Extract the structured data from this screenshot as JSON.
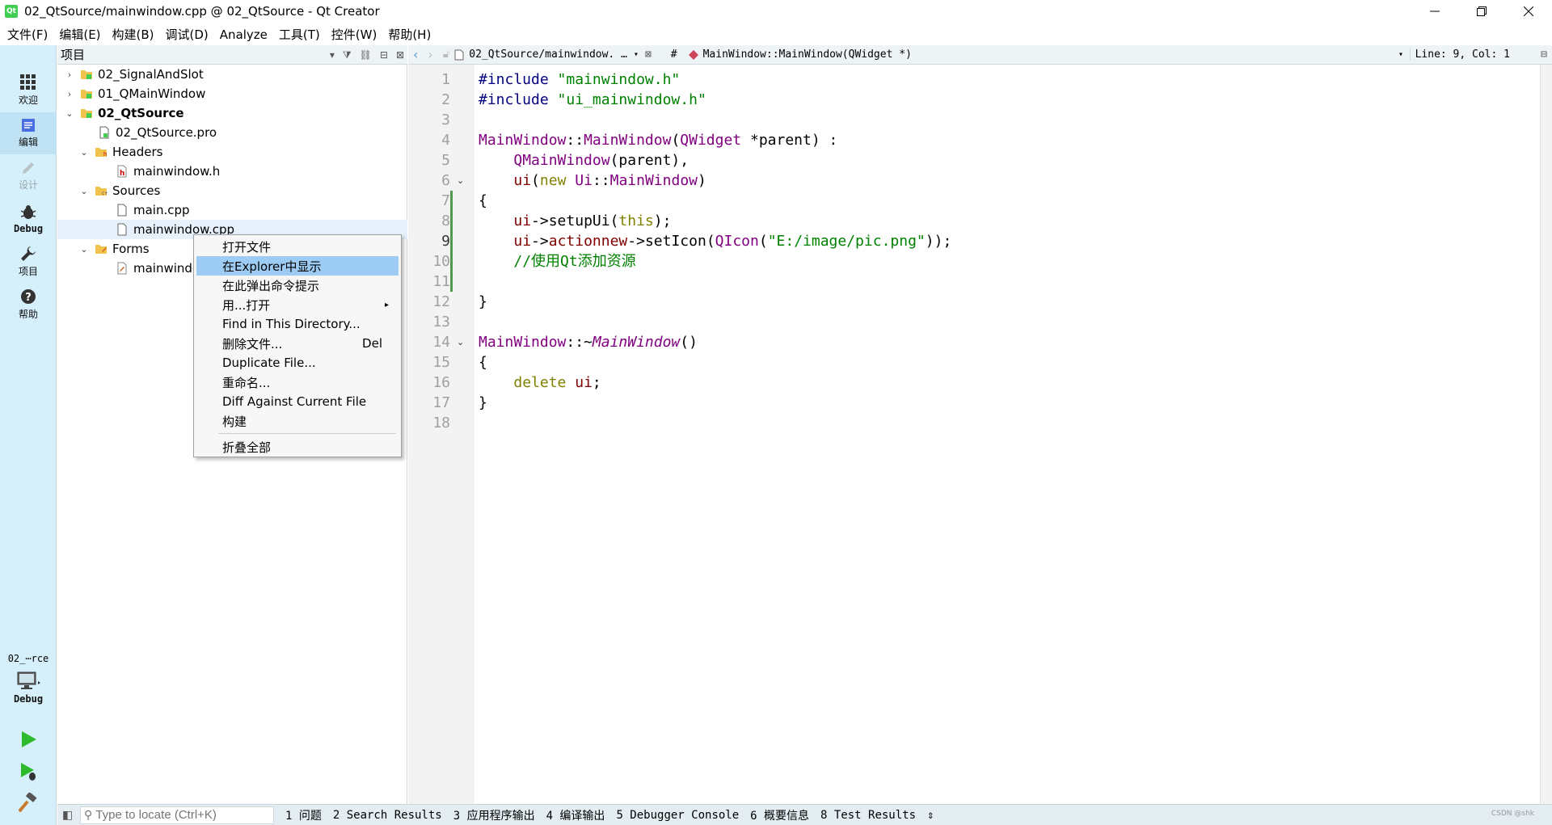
{
  "window": {
    "title": "02_QtSource/mainwindow.cpp @ 02_QtSource - Qt Creator",
    "icon_text": "Qt"
  },
  "menu": [
    "文件(F)",
    "编辑(E)",
    "构建(B)",
    "调试(D)",
    "Analyze",
    "工具(T)",
    "控件(W)",
    "帮助(H)"
  ],
  "modes": [
    {
      "label": "欢迎",
      "icon": "grid-icon"
    },
    {
      "label": "编辑",
      "icon": "edit-doc-icon"
    },
    {
      "label": "设计",
      "icon": "pencil-icon"
    },
    {
      "label": "Debug",
      "icon": "bug-icon"
    },
    {
      "label": "项目",
      "icon": "wrench-icon"
    },
    {
      "label": "帮助",
      "icon": "help-icon"
    }
  ],
  "kit": {
    "project": "02_⋯rce",
    "mode": "Debug"
  },
  "project_pane": {
    "header": "项目"
  },
  "tree": [
    {
      "label": "02_SignalAndSlot",
      "depth": 0,
      "arrow": "right",
      "icon": "project-folder-icon"
    },
    {
      "label": "01_QMainWindow",
      "depth": 0,
      "arrow": "right",
      "icon": "project-folder-icon"
    },
    {
      "label": "02_QtSource",
      "depth": 0,
      "arrow": "down",
      "icon": "project-folder-icon",
      "bold": true
    },
    {
      "label": "02_QtSource.pro",
      "depth": 1,
      "arrow": "",
      "icon": "pro-file-icon"
    },
    {
      "label": "Headers",
      "depth": 1,
      "arrow": "down",
      "icon": "headers-folder-icon"
    },
    {
      "label": "mainwindow.h",
      "depth": 2,
      "arrow": "",
      "icon": "header-file-icon"
    },
    {
      "label": "Sources",
      "depth": 1,
      "arrow": "down",
      "icon": "sources-folder-icon"
    },
    {
      "label": "main.cpp",
      "depth": 2,
      "arrow": "",
      "icon": "cpp-file-icon"
    },
    {
      "label": "mainwindow.cpp",
      "depth": 2,
      "arrow": "",
      "icon": "cpp-file-icon",
      "selected": true
    },
    {
      "label": "Forms",
      "depth": 1,
      "arrow": "down",
      "icon": "forms-folder-icon"
    },
    {
      "label": "mainwindow.ui",
      "depth": 2,
      "arrow": "",
      "icon": "ui-file-icon"
    }
  ],
  "context_menu": [
    {
      "label": "打开文件"
    },
    {
      "label": "在Explorer中显示",
      "highlighted": true
    },
    {
      "label": "在此弹出命令提示"
    },
    {
      "label": "用...打开",
      "submenu": true
    },
    {
      "label": "Find in This Directory..."
    },
    {
      "label": "删除文件...",
      "shortcut": "Del"
    },
    {
      "label": "Duplicate File..."
    },
    {
      "label": "重命名..."
    },
    {
      "label": "Diff Against Current File"
    },
    {
      "label": "构建"
    },
    {
      "label": "折叠全部",
      "after_separator": true
    }
  ],
  "editor_toolbar": {
    "file": "02_QtSource/mainwindow. …",
    "hash": "#",
    "symbol": "MainWindow::MainWindow(QWidget *)",
    "position": "Line: 9, Col: 1"
  },
  "code_lines": [
    {
      "n": "1",
      "html": "<span class='k-pp'>#include</span> <span class='k-str'>\"mainwindow.h\"</span>"
    },
    {
      "n": "2",
      "html": "<span class='k-pp'>#include</span> <span class='k-str'>\"ui_mainwindow.h\"</span>"
    },
    {
      "n": "3",
      "html": ""
    },
    {
      "n": "4",
      "html": "<span class='k-type'>MainWindow</span>::<span class='k-type'>MainWindow</span>(<span class='k-type'>QWidget</span> *parent) :"
    },
    {
      "n": "5",
      "html": "    <span class='k-type'>QMainWindow</span>(parent),"
    },
    {
      "n": "6",
      "html": "    <span class='k-mem'>ui</span>(<span class='k-kw'>new</span> <span class='k-type'>Ui</span>::<span class='k-type'>MainWindow</span>)"
    },
    {
      "n": "7",
      "html": "{"
    },
    {
      "n": "8",
      "html": "    <span class='k-mem'>ui</span>->setupUi(<span class='k-kw'>this</span>);"
    },
    {
      "n": "9",
      "html": "    <span class='k-mem'>ui</span>-><span class='k-mem'>actionnew</span>->setIcon(<span class='k-type'>QIcon</span>(<span class='k-str'>\"E:/image/pic.png\"</span>));"
    },
    {
      "n": "10",
      "html": "    <span class='k-cmt'>//使用Qt添加资源</span>"
    },
    {
      "n": "11",
      "html": ""
    },
    {
      "n": "12",
      "html": "}"
    },
    {
      "n": "13",
      "html": ""
    },
    {
      "n": "14",
      "html": "<span class='k-type'>MainWindow</span>::~<span class='k-type'><i>MainWindow</i></span>()"
    },
    {
      "n": "15",
      "html": "{"
    },
    {
      "n": "16",
      "html": "    <span class='k-kw'>delete</span> <span class='k-mem'>ui</span>;"
    },
    {
      "n": "17",
      "html": "}"
    },
    {
      "n": "18",
      "html": ""
    }
  ],
  "status_bar": {
    "locator_placeholder": "Type to locate (Ctrl+K)",
    "tabs": [
      "1 问题",
      "2 Search Results",
      "3 应用程序输出",
      "4 编译输出",
      "5 Debugger Console",
      "6 概要信息",
      "8 Test Results"
    ],
    "watermark": "CSDN @shk"
  },
  "colors": {
    "mode_bar_bg": "#d6f0fb",
    "highlight": "#9ccbf3",
    "qt_green": "#41cd52"
  }
}
